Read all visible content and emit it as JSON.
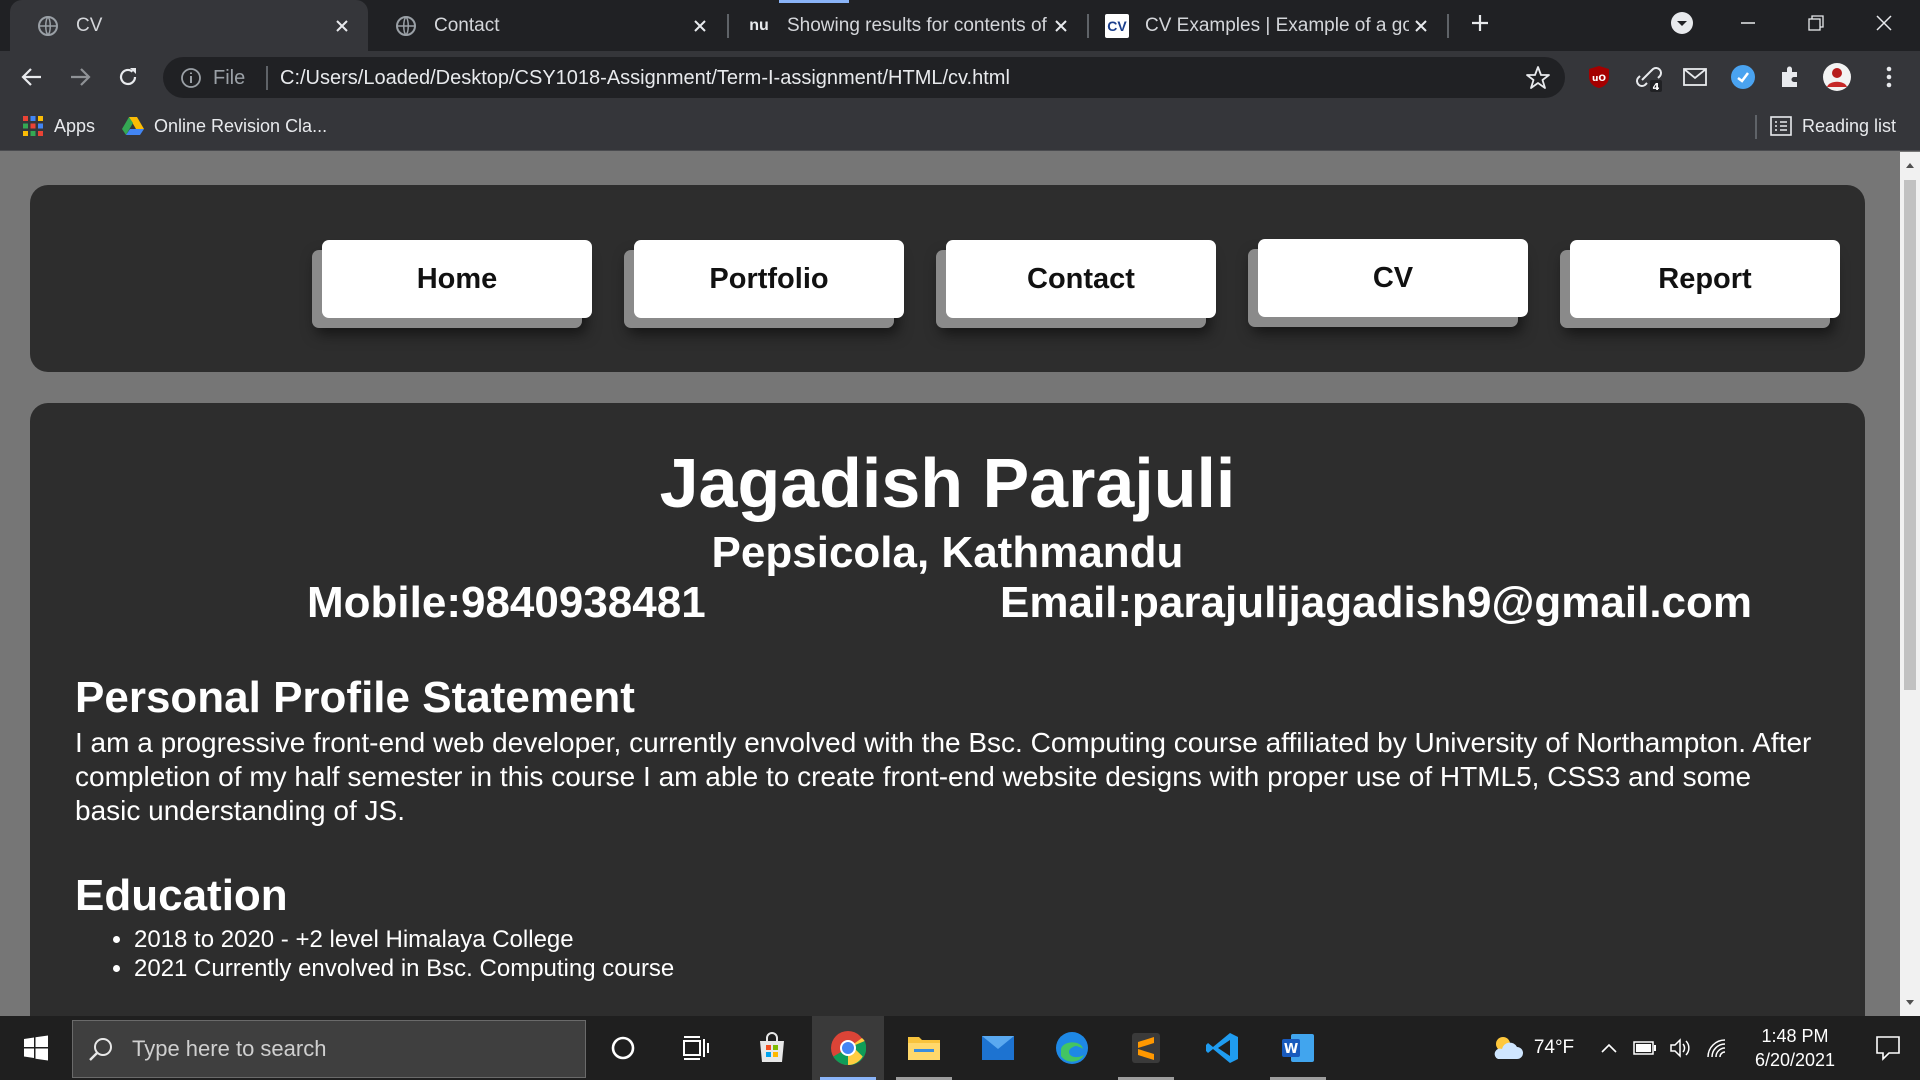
{
  "browser": {
    "tabs": [
      {
        "title": "CV",
        "active": true
      },
      {
        "title": "Contact",
        "active": false
      },
      {
        "title": "Showing results for contents of t",
        "active": false
      },
      {
        "title": "CV Examples | Example of a good",
        "active": false
      }
    ],
    "tab3_favicon_text": "nu",
    "tab4_favicon_text": "CV",
    "address": {
      "scheme_label": "File",
      "url": "C:/Users/Loaded/Desktop/CSY1018-Assignment/Term-I-assignment/HTML/cv.html"
    },
    "extension_badge": "4",
    "bookmarks": [
      {
        "label": "Apps"
      },
      {
        "label": "Online Revision Cla..."
      }
    ],
    "reading_list_label": "Reading list",
    "accent_color": "#8ab4f8"
  },
  "site": {
    "nav": [
      "Home",
      "Portfolio",
      "Contact",
      "CV",
      "Report"
    ],
    "name": "Jagadish Parajuli",
    "address": "Pepsicola, Kathmandu",
    "mobile": "Mobile:9840938481",
    "email": "Email:parajulijagadish9@gmail.com",
    "profile_heading": "Personal Profile Statement",
    "profile_text": "I am a progressive front-end web developer, currently envolved with the Bsc. Computing course affiliated by University of Northampton. After completion of my half semester in this course I am able to create front-end website designs with proper use of HTML5, CSS3 and some basic understanding of JS.",
    "education_heading": "Education",
    "education": [
      "2018 to 2020 - +2 level Himalaya College",
      "2021 Currently envolved in Bsc. Computing course"
    ],
    "panel_color": "#2d2d2d",
    "page_bg_color": "#767676"
  },
  "taskbar": {
    "search_placeholder": "Type here to search",
    "weather": "74°F",
    "time": "1:48 PM",
    "date": "6/20/2021"
  }
}
